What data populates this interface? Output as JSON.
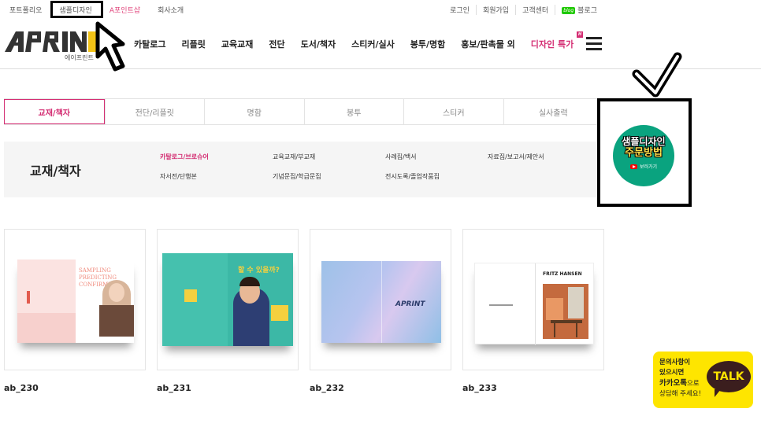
{
  "topbar": {
    "left_links": [
      "포트폴리오",
      "샘플디자인",
      "A포인트샵",
      "회사소개"
    ],
    "right_links": [
      "로그인",
      "회원가입",
      "고객센터",
      "블로그"
    ],
    "blog_badge": "blog"
  },
  "header": {
    "logo_text": "APRINT",
    "logo_subtext": "에이프린트",
    "nav": [
      "카탈로그",
      "리플릿",
      "교육교재",
      "전단",
      "도서/책자",
      "스티커/실사",
      "봉투/명함",
      "홍보/판촉물 외",
      "디자인 특가"
    ],
    "nav_badge": "H"
  },
  "tabs": [
    "교재/책자",
    "전단/리플릿",
    "명함",
    "봉투",
    "스티커",
    "실사출력"
  ],
  "subpanel": {
    "title": "교재/책자",
    "items": [
      "카탈로그/브로슈어",
      "교육교재/부교재",
      "사례집/백서",
      "자료집/보고서/제안서",
      "자서전/단행본",
      "기념문집/학급문집",
      "전시도록/졸업작품집"
    ]
  },
  "sample_box": {
    "line1": "샘플디자인",
    "line2": "주문방법",
    "line3": "보러가기"
  },
  "products": [
    {
      "name": "ab_230",
      "cover_text": "SAMPLING PREDICTING CONFIRMING"
    },
    {
      "name": "ab_231",
      "cover_text": "할 수 있을까?"
    },
    {
      "name": "ab_232",
      "cover_text": "APRINT"
    },
    {
      "name": "ab_233",
      "cover_text": "FRITZ HANSEN"
    }
  ],
  "kakao": {
    "line1": "문의사항이",
    "line2": "있으시면",
    "line3_strong": "카카오톡",
    "line3_rest": "으로",
    "line4": "상담해 주세요!",
    "badge": "TALK"
  },
  "colors": {
    "accent": "#d42e73",
    "sample_green": "#0aa37f",
    "kakao_yellow": "#fee500"
  }
}
